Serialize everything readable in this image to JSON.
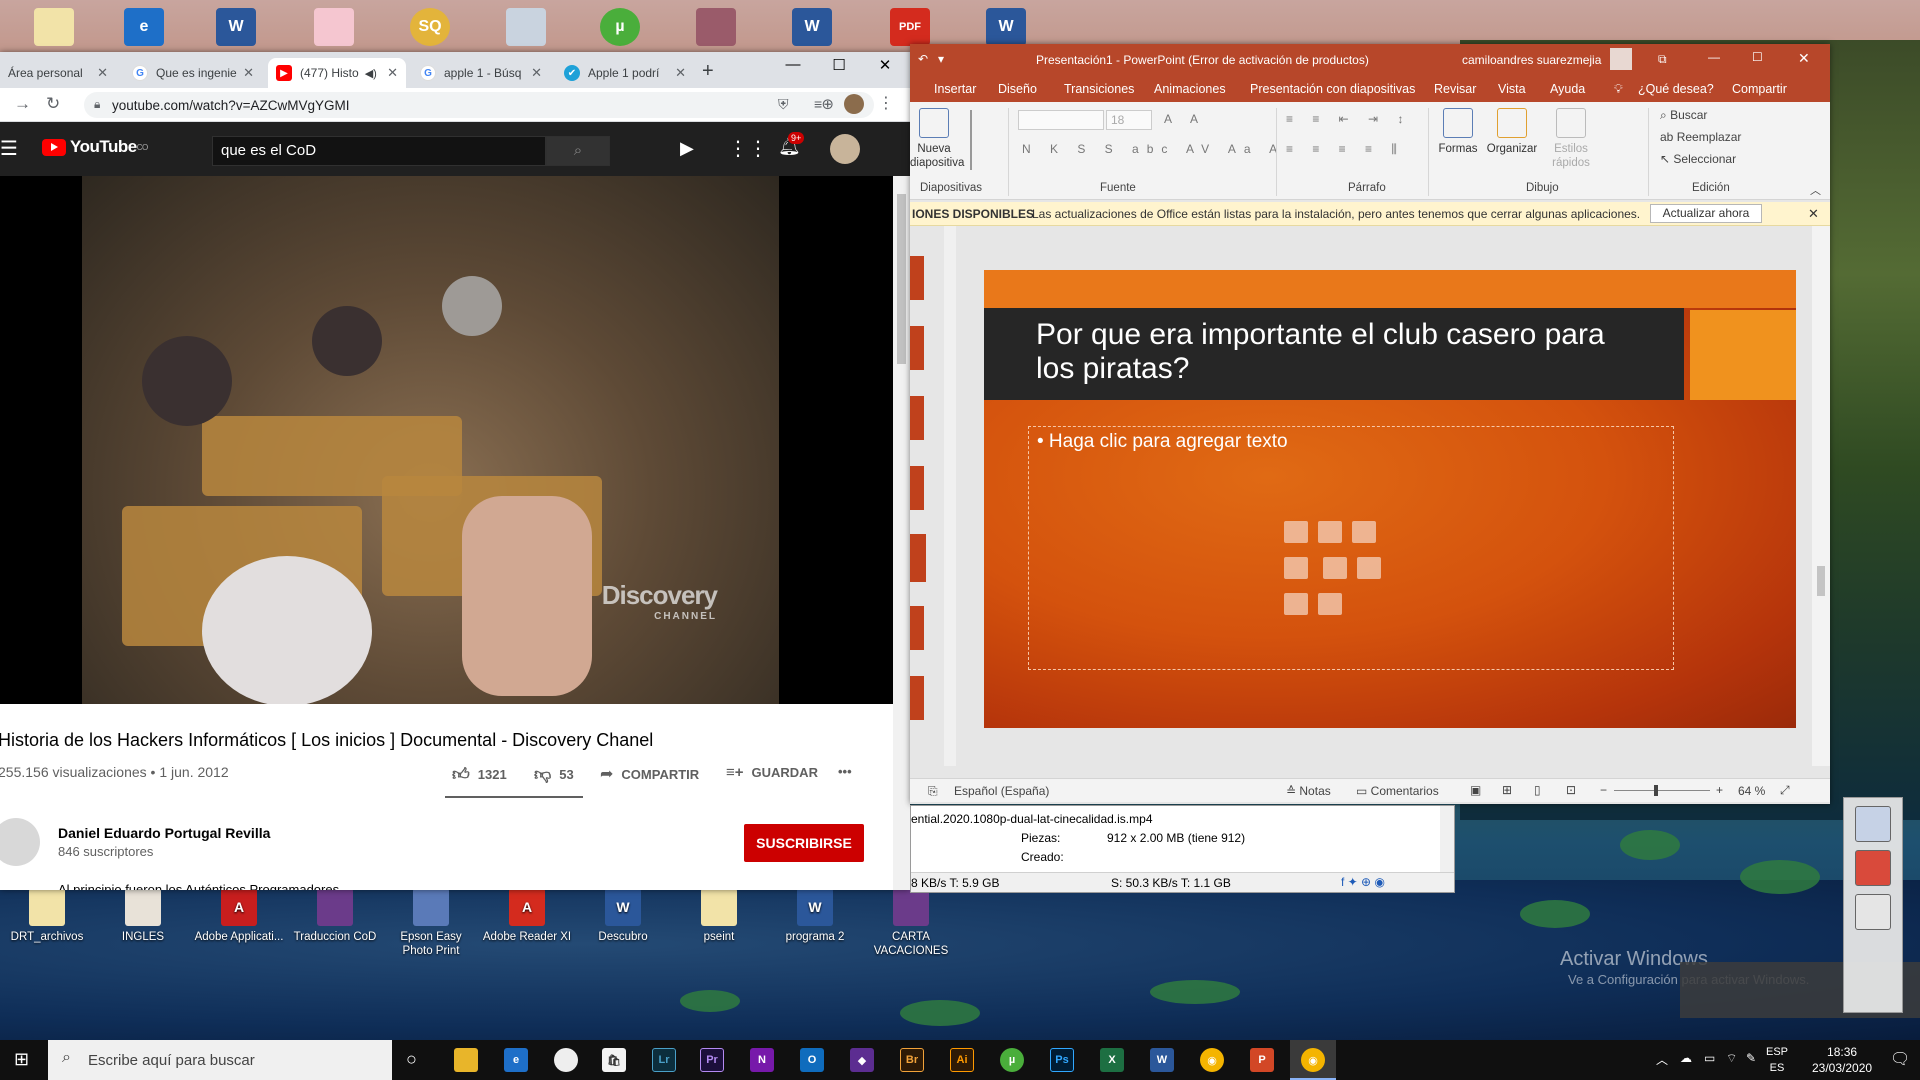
{
  "desktop": {
    "bottom_icons": [
      {
        "label": "DRT_archivos"
      },
      {
        "label": "INGLES"
      },
      {
        "label": "Adobe Applicati..."
      },
      {
        "label": "Traduccion CoD"
      },
      {
        "label": "Epson Easy Photo Print"
      },
      {
        "label": "Adobe Reader XI"
      },
      {
        "label": "Descubro"
      },
      {
        "label": "pseint"
      },
      {
        "label": "programa 2"
      },
      {
        "label": "CARTA VACACIONES"
      }
    ],
    "watermark": "Activar Windows",
    "watermark_sub": "Ve a Configuración para activar Windows."
  },
  "chrome": {
    "tabs": [
      {
        "label": "Área personal"
      },
      {
        "label": "Que es ingenie"
      },
      {
        "label": "(477) Histo"
      },
      {
        "label": "apple 1 - Búsq"
      },
      {
        "label": "Apple 1 podrí"
      }
    ],
    "new_tab": "+",
    "url": "youtube.com/watch?v=AZCwMVgYGMI",
    "youtube": {
      "logo": "YouTube",
      "logo_sup": "CO",
      "search_value": "que es el CoD",
      "notifications": "9+",
      "video_watermark": "Discovery",
      "video_watermark_sub": "CHANNEL",
      "title": "Historia de los Hackers Informáticos [ Los inicios ] Documental - Discovery Chanel",
      "meta": "255.156 visualizaciones • 1 jun. 2012",
      "likes": "1321",
      "dislikes": "53",
      "share": "COMPARTIR",
      "save": "GUARDAR",
      "more": "•••",
      "channel_name": "Daniel Eduardo Portugal Revilla",
      "channel_subs": "846 suscriptores",
      "subscribe": "SUSCRIBIRSE",
      "description_peek": "Al principio fueron los Auténticos Programadores..."
    }
  },
  "powerpoint": {
    "title": "Presentación1 - PowerPoint (Error de activación de productos)",
    "user": "camiloandres suarezmejia",
    "menu": [
      "Insertar",
      "Diseño",
      "Transiciones",
      "Animaciones",
      "Presentación con diapositivas",
      "Revisar",
      "Vista",
      "Ayuda",
      "¿Qué desea?",
      "Compartir"
    ],
    "ribbon": {
      "new_slide": "Nueva diapositiva",
      "font_size": "18",
      "shapes": "Formas",
      "arrange": "Organizar",
      "quick_styles": "Estilos rápidos",
      "find": "Buscar",
      "replace": "Reemplazar",
      "select": "Seleccionar",
      "groups": [
        "Diapositivas",
        "Fuente",
        "Párrafo",
        "Dibujo",
        "Edición"
      ]
    },
    "infobar": {
      "label": "IONES DISPONIBLES",
      "message": "Las actualizaciones de Office están listas para la instalación, pero antes tenemos que cerrar algunas aplicaciones.",
      "button": "Actualizar ahora"
    },
    "slide": {
      "title": "Por que era importante el club casero para los piratas?",
      "body_placeholder": "• Haga clic para agregar texto"
    },
    "status": {
      "language": "Español (España)",
      "notes": "Notas",
      "comments": "Comentarios",
      "zoom": "64 %"
    }
  },
  "download": {
    "filename": "ential.2020.1080p-dual-lat-cinecalidad.is.mp4",
    "pieces_label": "Piezas:",
    "pieces_value": "912 x 2.00 MB (tiene 912)",
    "created_label": "Creado:",
    "status_left": "8 KB/s T: 5.9 GB",
    "status_right": "S: 50.3 KB/s T: 1.1 GB"
  },
  "taskbar": {
    "search_placeholder": "Escribe aquí para buscar",
    "lang_top": "ESP",
    "lang_bottom": "ES",
    "time": "18:36",
    "date": "23/03/2020"
  }
}
